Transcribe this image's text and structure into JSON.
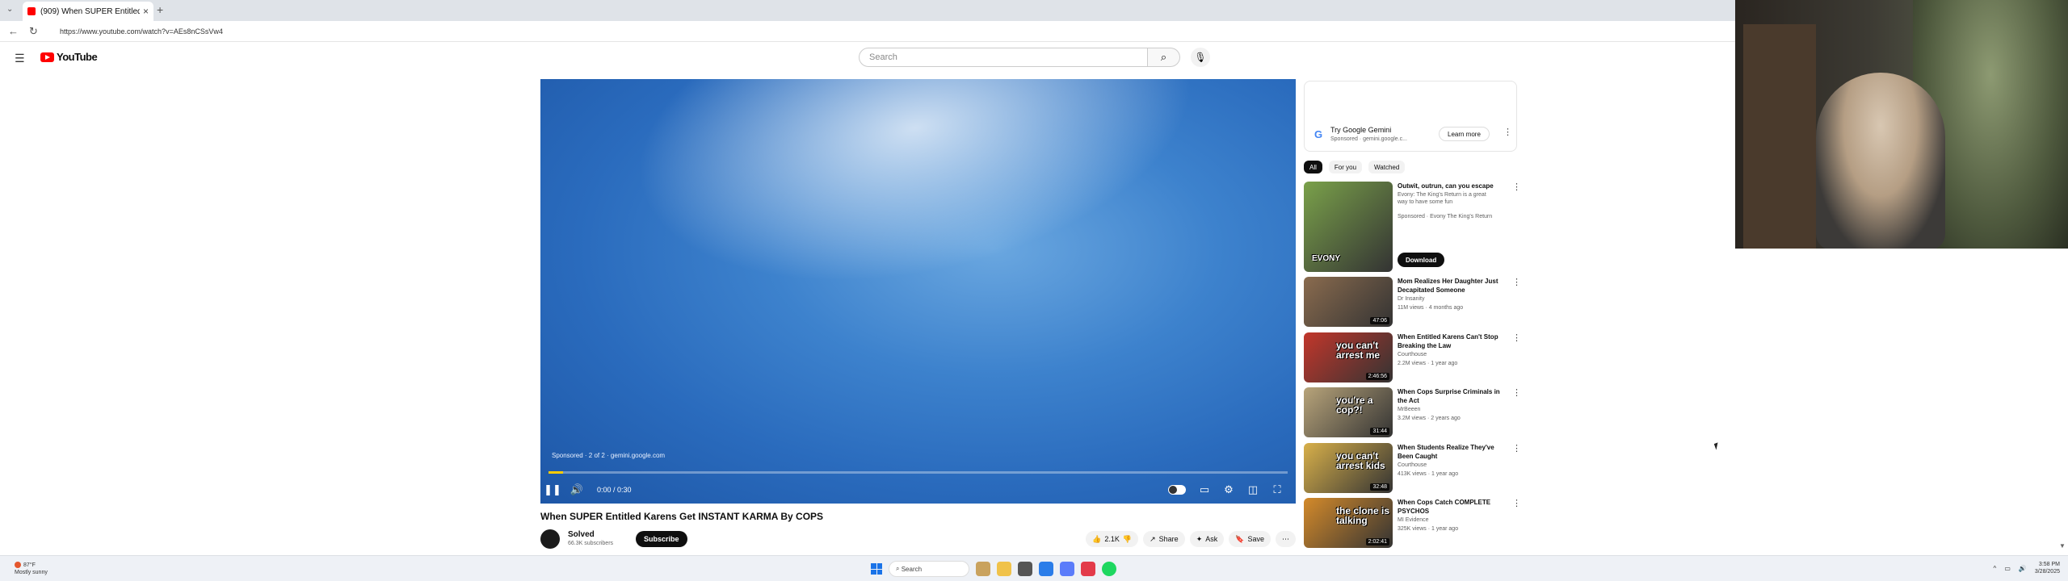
{
  "browser": {
    "tab_title": "(909) When SUPER Entitled K",
    "tab_close": "×",
    "new_tab": "+",
    "url": "https://www.youtube.com/watch?v=AEs8nCSsVw4"
  },
  "header": {
    "logo_text": "YouTube",
    "search_placeholder": "Search"
  },
  "player": {
    "sponsor_text": "Sponsored · 2 of 2 · gemini.google.com",
    "time": "0:00 / 0:30",
    "progress_fraction": 0.02,
    "colors": {
      "progress": "#ffcc00"
    }
  },
  "video": {
    "title": "When SUPER Entitled Karens Get INSTANT KARMA By COPS",
    "channel": "Solved",
    "subscribers": "66.3K subscribers",
    "subscribe_label": "Subscribe",
    "like_count": "2.1K",
    "share_label": "Share",
    "ask_label": "Ask",
    "save_label": "Save"
  },
  "ad": {
    "title": "Try Google Gemini",
    "meta": "Sponsored · gemini.google.c...",
    "learn_more": "Learn more"
  },
  "chips": [
    "All",
    "For you",
    "Watched"
  ],
  "recommendations": [
    {
      "title": "Outwit, outrun, can you escape",
      "channel": "Evony: The King's Return is a great way to have some fun",
      "meta": "Sponsored · Evony The King's Return",
      "duration": "",
      "caption": "EVONY",
      "button": "Download",
      "thumb_color": "#7aa14a"
    },
    {
      "title": "Mom Realizes Her Daughter Just Decapitated Someone",
      "channel": "Dr Insanity",
      "meta": "11M views · 4 months ago",
      "duration": "47:06",
      "caption": "",
      "thumb_color": "#8a6b4e"
    },
    {
      "title": "When Entitled Karens Can't Stop Breaking the Law",
      "channel": "Courthouse",
      "meta": "2.2M views · 1 year ago",
      "duration": "2:46:56",
      "caption": "you can't arrest me",
      "thumb_color": "#c2362b"
    },
    {
      "title": "When Cops Surprise Criminals in the Act",
      "channel": "MrBeeen",
      "meta": "3.2M views · 2 years ago",
      "duration": "31:44",
      "caption": "you're a cop?!",
      "thumb_color": "#b8a47a"
    },
    {
      "title": "When Students Realize They've Been Caught",
      "channel": "Courthouse",
      "meta": "413K views · 1 year ago",
      "duration": "32:48",
      "caption": "you can't arrest kids",
      "thumb_color": "#d8b04a"
    },
    {
      "title": "When Cops Catch COMPLETE PSYCHOS",
      "channel": "MI Evidence",
      "meta": "325K views · 1 year ago",
      "duration": "2:02:41",
      "caption": "the clone is talking",
      "thumb_color": "#d48a2a"
    }
  ],
  "taskbar": {
    "weather_temp": "87°F",
    "weather_desc": "Mostly sunny",
    "search": "Search",
    "time": "3:58 PM",
    "date": "3/28/2025"
  }
}
